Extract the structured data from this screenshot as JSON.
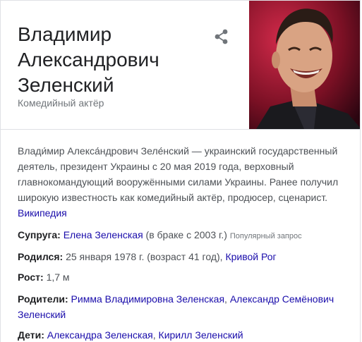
{
  "header": {
    "title_lines": [
      "Владимир",
      "Александрович",
      "Зеленский"
    ],
    "subtitle": "Комедийный актёр",
    "share_icon": "share-icon",
    "photo_desc": "portrait"
  },
  "description": {
    "text": "Влади́мир Алекса́ндрович Зеле́нский — украинский государственный деятель, президент Украины с 20 мая 2019 года, верховный главнокомандующий вооружёнными силами Украины. Ранее получил широкую известность как комедийный актёр, продюсер, сценарист.",
    "source": "Википедия"
  },
  "facts": {
    "spouse": {
      "label": "Супруга:",
      "name": "Елена Зеленская",
      "note": "(в браке с 2003 г.)",
      "popular": "Популярный запрос"
    },
    "born": {
      "label": "Родился:",
      "date": "25 января 1978 г. (возраст 41 год),",
      "place": "Кривой Рог"
    },
    "height": {
      "label": "Рост:",
      "value": "1,7 м"
    },
    "parents": {
      "label": "Родители:",
      "mother": "Римма Владимировна Зеленская",
      "sep": ",",
      "father": "Александр Семёнович Зеленский"
    },
    "children": {
      "label": "Дети:",
      "child1": "Александра Зеленская",
      "sep": ",",
      "child2": "Кирилл Зеленский"
    }
  },
  "colors": {
    "link": "#1a0dab",
    "text": "#4d5156",
    "title": "#202124",
    "muted": "#70757a",
    "border": "#dfe1e5"
  }
}
